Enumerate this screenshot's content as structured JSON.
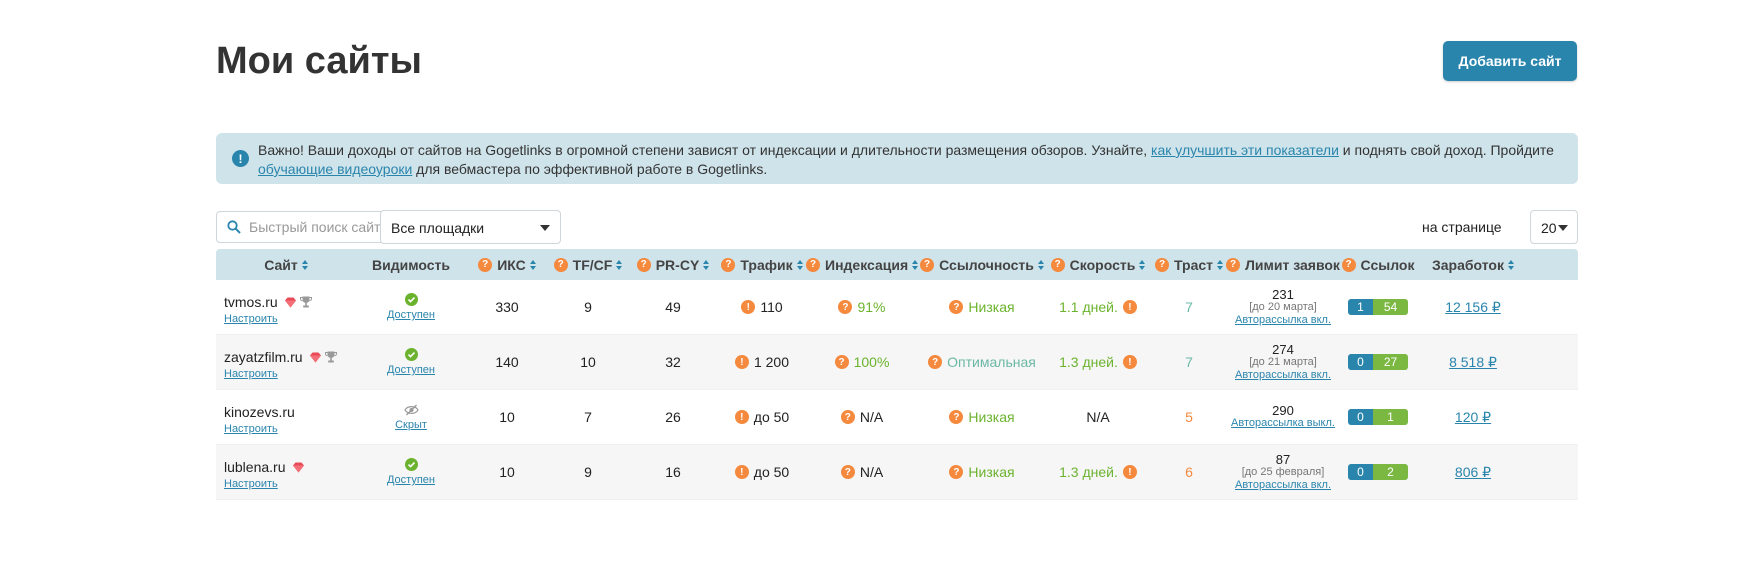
{
  "page": {
    "title": "Мои сайты",
    "add_button": "Добавить сайт"
  },
  "notice": {
    "text_1": "Важно! Ваши доходы от сайтов на Gogetlinks в огромной степени зависят от индексации и длительности размещения обзоров. Узнайте, ",
    "link_1": "как улучшить эти показатели",
    "text_2": " и поднять свой доход. Пройдите ",
    "link_2": "обучающие видеоуроки",
    "text_3": " для вебмастера по эффективной работе в Gogetlinks."
  },
  "filters": {
    "search_placeholder": "Быстрый поиск сайта",
    "platform_select": "Все площадки",
    "per_page_label": "на странице",
    "per_page_value": "20"
  },
  "columns": {
    "site": "Сайт",
    "visibility": "Видимость",
    "iks": "ИКС",
    "tfcf": "TF/CF",
    "prcy": "PR-CY",
    "traffic": "Трафик",
    "indexing": "Индексация",
    "linkiness": "Ссылочность",
    "speed": "Скорость",
    "trust": "Траст",
    "limit": "Лимит заявок",
    "links": "Ссылок",
    "earnings": "Заработок"
  },
  "rows": [
    {
      "site": "tvmos.ru",
      "configure": "Настроить",
      "visibility": "Доступен",
      "iks": "330",
      "tfcf": "9",
      "prcy": "49",
      "traffic": "110",
      "indexing": "91%",
      "linkiness": "Низкая",
      "speed": "1.1 дней.",
      "trust": "7",
      "limit_num": "231",
      "limit_date": "[до 20 марта]",
      "limit_auto": "Авторассылка вкл.",
      "links_blue": "1",
      "links_green": "54",
      "earnings": "12 156 ₽"
    },
    {
      "site": "zayatzfilm.ru",
      "configure": "Настроить",
      "visibility": "Доступен",
      "iks": "140",
      "tfcf": "10",
      "prcy": "32",
      "traffic": "1 200",
      "indexing": "100%",
      "linkiness": "Оптимальная",
      "speed": "1.3 дней.",
      "trust": "7",
      "limit_num": "274",
      "limit_date": "[до 21 марта]",
      "limit_auto": "Авторассылка вкл.",
      "links_blue": "0",
      "links_green": "27",
      "earnings": "8 518 ₽"
    },
    {
      "site": "kinozevs.ru",
      "configure": "Настроить",
      "visibility": "Скрыт",
      "iks": "10",
      "tfcf": "7",
      "prcy": "26",
      "traffic": "до 50",
      "indexing": "N/A",
      "linkiness": "Низкая",
      "speed": "N/A",
      "trust": "5",
      "limit_num": "290",
      "limit_date": "",
      "limit_auto": "Авторассылка выкл.",
      "links_blue": "0",
      "links_green": "1",
      "earnings": "120 ₽"
    },
    {
      "site": "lublena.ru",
      "configure": "Настроить",
      "visibility": "Доступен",
      "iks": "10",
      "tfcf": "9",
      "prcy": "16",
      "traffic": "до 50",
      "indexing": "N/A",
      "linkiness": "Низкая",
      "speed": "1.3 дней.",
      "trust": "6",
      "limit_num": "87",
      "limit_date": "[до 25 февраля]",
      "limit_auto": "Авторассылка вкл.",
      "links_blue": "0",
      "links_green": "2",
      "earnings": "806 ₽"
    }
  ],
  "colors": {
    "accent": "#2a85ad",
    "notice_bg": "#cfe3ea",
    "good": "#6bb32e",
    "warn": "#f5893d",
    "links_green": "#7bb841"
  }
}
